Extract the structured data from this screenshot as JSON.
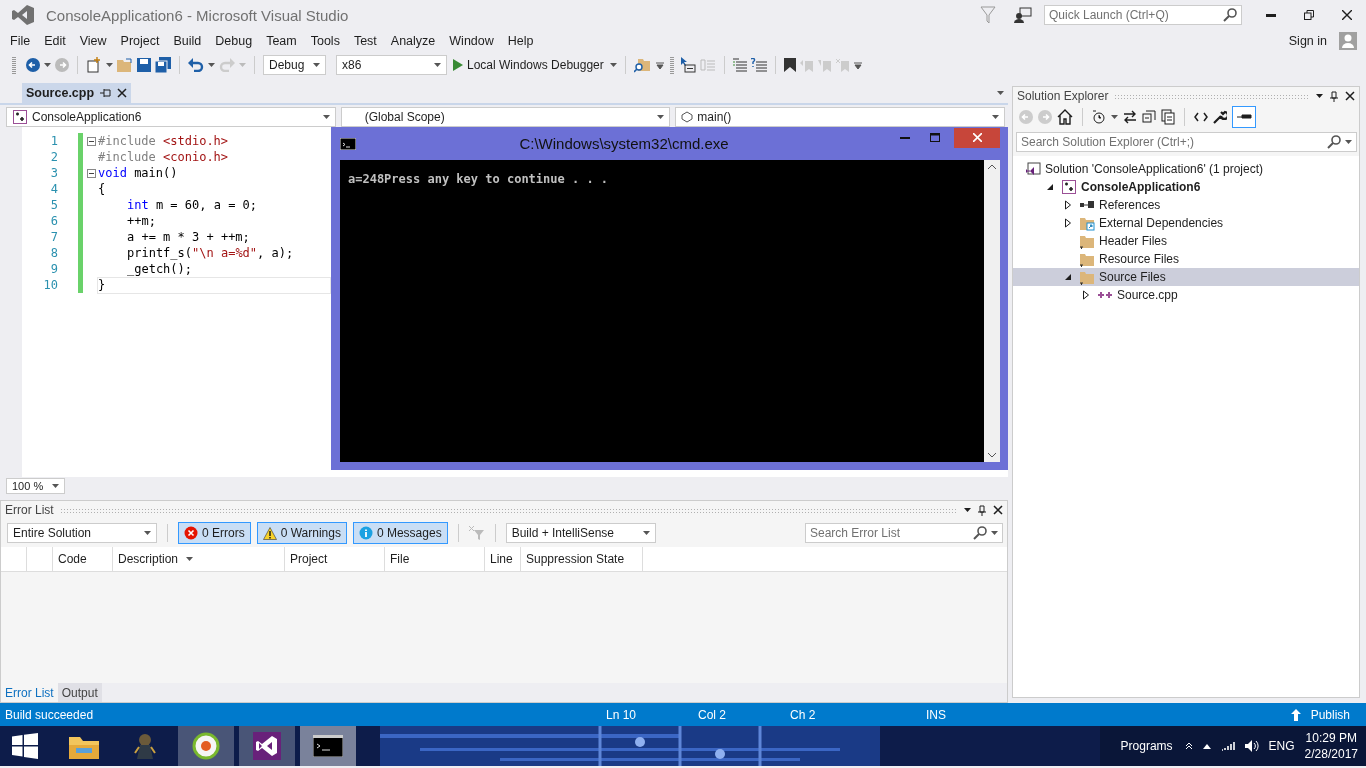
{
  "window": {
    "title": "ConsoleApplication6 - Microsoft Visual Studio"
  },
  "quick_launch": {
    "placeholder": "Quick Launch (Ctrl+Q)"
  },
  "menu": [
    "File",
    "Edit",
    "View",
    "Project",
    "Build",
    "Debug",
    "Team",
    "Tools",
    "Test",
    "Analyze",
    "Window",
    "Help"
  ],
  "account": {
    "label": "Sign in"
  },
  "toolbar": {
    "configuration": "Debug",
    "platform": "x86",
    "start": "Local Windows Debugger"
  },
  "editor": {
    "tabs": [
      {
        "label": "Source.cpp",
        "selected": true
      }
    ],
    "nav": [
      "ConsoleApplication6",
      "(Global Scope)",
      "main()"
    ],
    "lines": [
      {
        "number": "1",
        "fold": true,
        "current": false,
        "indented": false,
        "tokens": [
          {
            "kind": "pre",
            "text": "#include "
          },
          {
            "kind": "str",
            "text": "<stdio.h>"
          }
        ]
      },
      {
        "number": "2",
        "fold": false,
        "current": false,
        "indented": false,
        "tokens": [
          {
            "kind": "pre",
            "text": "#include "
          },
          {
            "kind": "str",
            "text": "<conio.h>"
          }
        ]
      },
      {
        "number": "3",
        "fold": true,
        "current": false,
        "indented": false,
        "tokens": [
          {
            "kind": "kw",
            "text": "void"
          },
          {
            "kind": "txt",
            "text": " main()"
          }
        ]
      },
      {
        "number": "4",
        "fold": false,
        "current": false,
        "indented": false,
        "tokens": [
          {
            "kind": "txt",
            "text": "{"
          }
        ]
      },
      {
        "number": "5",
        "fold": false,
        "current": false,
        "indented": true,
        "tokens": [
          {
            "kind": "kw",
            "text": "int"
          },
          {
            "kind": "txt",
            "text": " m = 60, a = 0;"
          }
        ]
      },
      {
        "number": "6",
        "fold": false,
        "current": false,
        "indented": true,
        "tokens": [
          {
            "kind": "txt",
            "text": "++m;"
          }
        ]
      },
      {
        "number": "7",
        "fold": false,
        "current": false,
        "indented": true,
        "tokens": [
          {
            "kind": "txt",
            "text": "a += m * 3 + ++m;"
          }
        ]
      },
      {
        "number": "8",
        "fold": false,
        "current": false,
        "indented": true,
        "tokens": [
          {
            "kind": "txt",
            "text": "printf_s("
          },
          {
            "kind": "str",
            "text": "\"\\n a=%d\""
          },
          {
            "kind": "txt",
            "text": ", a);"
          }
        ]
      },
      {
        "number": "9",
        "fold": false,
        "current": false,
        "indented": true,
        "tokens": [
          {
            "kind": "txt",
            "text": "_getch();"
          }
        ]
      },
      {
        "number": "10",
        "fold": false,
        "current": true,
        "indented": false,
        "tokens": [
          {
            "kind": "txt",
            "text": "}"
          }
        ]
      }
    ],
    "zoom": "100 %"
  },
  "console": {
    "title": "C:\\Windows\\system32\\cmd.exe",
    "output": "a=248Press any key to continue . . ."
  },
  "error_list": {
    "title": "Error List",
    "scope": "Entire Solution",
    "filters": [
      {
        "kind": "error",
        "label": "0 Errors",
        "selected": true
      },
      {
        "kind": "warning",
        "label": "0 Warnings",
        "selected": true
      },
      {
        "kind": "message",
        "label": "0 Messages",
        "selected": true
      }
    ],
    "source": "Build + IntelliSense",
    "search": {
      "placeholder": "Search Error List"
    },
    "columns": [
      "Code",
      "Description",
      "Project",
      "File",
      "Line",
      "Suppression State"
    ],
    "tabs": [
      {
        "label": "Error List",
        "selected": true
      },
      {
        "label": "Output",
        "selected": false
      }
    ]
  },
  "solution_explorer": {
    "title": "Solution Explorer",
    "search": {
      "placeholder": "Search Solution Explorer (Ctrl+;)"
    },
    "tree": [
      {
        "kind": "solution",
        "label": "Solution 'ConsoleApplication6' (1 project)",
        "selected": false,
        "children": [
          {
            "kind": "project",
            "label": "ConsoleApplication6",
            "selected": false,
            "expanded": true,
            "children": [
              {
                "kind": "references",
                "label": "References",
                "selected": false,
                "expanded": false
              },
              {
                "kind": "external",
                "label": "External Dependencies",
                "selected": false,
                "expanded": false
              },
              {
                "kind": "folder",
                "label": "Header Files",
                "selected": false
              },
              {
                "kind": "folder",
                "label": "Resource Files",
                "selected": false
              },
              {
                "kind": "folder",
                "label": "Source Files",
                "selected": true,
                "expanded": true,
                "children": [
                  {
                    "kind": "cpp",
                    "label": "Source.cpp",
                    "selected": false,
                    "expanded": false
                  }
                ]
              }
            ]
          }
        ]
      }
    ]
  },
  "status_bar": {
    "message": "Build succeeded",
    "line": "Ln 10",
    "column": "Col 2",
    "char": "Ch 2",
    "mode": "INS",
    "publish": "Publish"
  },
  "taskbar": {
    "apps": [
      {
        "kind": "explorer",
        "open": false,
        "selected": false
      },
      {
        "kind": "game",
        "open": false,
        "selected": false
      },
      {
        "kind": "browser",
        "open": true,
        "selected": false
      },
      {
        "kind": "studio",
        "open": true,
        "selected": false
      },
      {
        "kind": "console",
        "open": true,
        "selected": true
      }
    ],
    "programs": "Programs",
    "language": "ENG",
    "time": "10:29 PM",
    "date": "2/28/2017"
  }
}
